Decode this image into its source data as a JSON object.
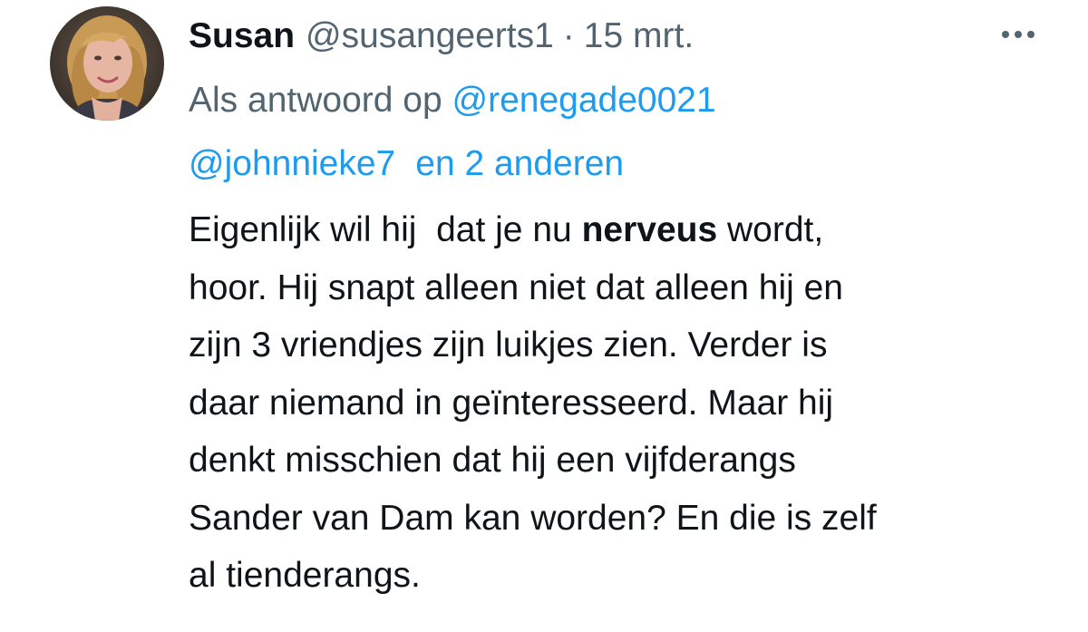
{
  "tweet": {
    "display_name": "Susan",
    "handle": "@susangeerts1",
    "separator": "·",
    "date": "15 mrt.",
    "reply_prefix": "Als antwoord op",
    "reply_to_1": "@renegade0021",
    "reply_to_2": "@johnnieke7",
    "reply_others": "en 2 anderen",
    "body": {
      "l1_a": "Eigenlijk wil hij  dat je nu ",
      "l1_bold": "nerveus",
      "l1_b": " wordt,",
      "l2": "hoor. Hij snapt alleen niet dat alleen hij en",
      "l3": "zijn 3 vriendjes zijn luikjes zien. Verder is",
      "l4": "daar niemand in geïnteresseerd. Maar hij",
      "l5": "denkt misschien dat hij een vijfderangs",
      "l6": "Sander van Dam kan worden? En die is zelf",
      "l7": "al tienderangs."
    }
  },
  "icons": {
    "more": "more-horizontal-icon",
    "avatar": "profile-photo"
  },
  "colors": {
    "link": "#1d9bf0",
    "secondary_text": "#536471",
    "primary_text": "#0f1419"
  }
}
